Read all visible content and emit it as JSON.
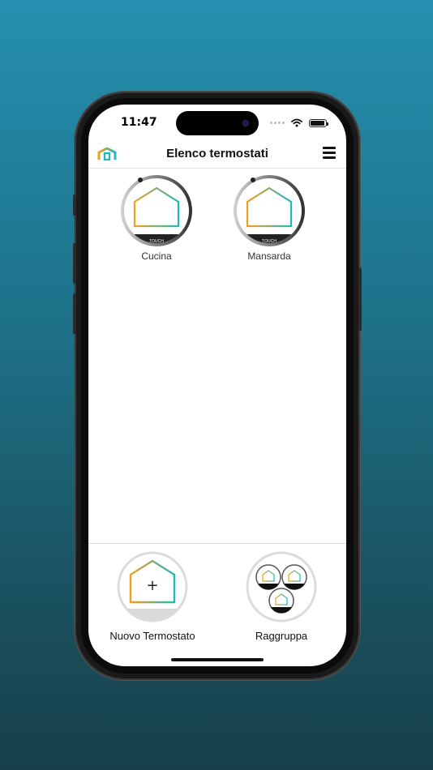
{
  "status_bar": {
    "time": "11:47"
  },
  "header": {
    "title": "Elenco termostati"
  },
  "thermostats": [
    {
      "name": "Cucina",
      "badge": "TOUCH"
    },
    {
      "name": "Mansarda",
      "badge": "TOUCH"
    }
  ],
  "actions": {
    "new_thermostat": {
      "label": "Nuovo Termostato",
      "symbol": "+"
    },
    "group": {
      "label": "Raggruppa"
    }
  },
  "colors": {
    "background_top": "#2590b0",
    "background_bottom": "#17404b",
    "house_orange": "#f0a020",
    "house_teal": "#20b8c0",
    "dial_ring": "#444444"
  },
  "icons": {
    "logo": "house-logo-icon",
    "menu": "hamburger-menu-icon",
    "wifi": "wifi-icon",
    "battery": "battery-icon"
  }
}
